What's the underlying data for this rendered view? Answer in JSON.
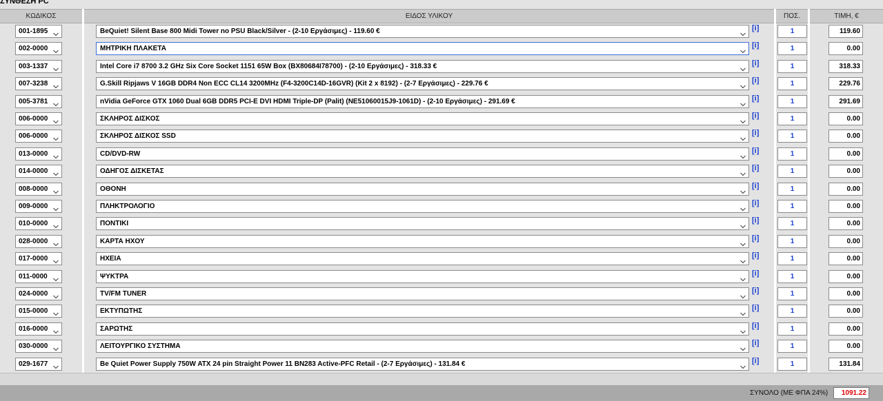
{
  "page_title": "ΣΥΝΘΕΣΗ PC",
  "headers": {
    "code": "ΚΩΔΙΚΟΣ",
    "item": "ΕΙΔΟΣ ΥΛΙΚΟΥ",
    "qty": "ΠΟΣ.",
    "price": "ΤΙΜΗ, €"
  },
  "info_label": "[i]",
  "rows": [
    {
      "code": "001-1895",
      "item": "BeQuiet! Silent Base 800 Midi Tower no PSU Black/Silver - (2-10 Εργάσιμες) - 119.60 €",
      "qty": "1",
      "price": "119.60"
    },
    {
      "code": "002-0000",
      "item": "ΜΗΤΡΙΚΗ ΠΛΑΚΕΤΑ",
      "qty": "1",
      "price": "0.00"
    },
    {
      "code": "003-1337",
      "item": "Intel Core i7 8700 3.2 GHz Six Core Socket 1151 65W Box (BX80684I78700) - (2-10 Εργάσιμες) - 318.33 €",
      "qty": "1",
      "price": "318.33"
    },
    {
      "code": "007-3238",
      "item": "G.Skill Ripjaws V 16GB DDR4 Non ECC CL14 3200MHz (F4-3200C14D-16GVR) (Kit 2 x 8192) - (2-7 Εργάσιμες) - 229.76 €",
      "qty": "1",
      "price": "229.76"
    },
    {
      "code": "005-3781",
      "item": "nVidia GeForce GTX 1060 Dual 6GB DDR5 PCI-E DVI HDMI Triple-DP (Palit) (NE51060015J9-1061D) - (2-10 Εργάσιμες) - 291.69 €",
      "qty": "1",
      "price": "291.69"
    },
    {
      "code": "006-0000",
      "item": "ΣΚΛΗΡΟΣ ΔΙΣΚΟΣ",
      "qty": "1",
      "price": "0.00"
    },
    {
      "code": "006-0000",
      "item": "ΣΚΛΗΡΟΣ ΔΙΣΚΟΣ SSD",
      "qty": "1",
      "price": "0.00"
    },
    {
      "code": "013-0000",
      "item": "CD/DVD-RW",
      "qty": "1",
      "price": "0.00"
    },
    {
      "code": "014-0000",
      "item": "ΟΔΗΓΟΣ ΔΙΣΚΕΤΑΣ",
      "qty": "1",
      "price": "0.00"
    },
    {
      "code": "008-0000",
      "item": "ΟΘΟΝΗ",
      "qty": "1",
      "price": "0.00"
    },
    {
      "code": "009-0000",
      "item": "ΠΛΗΚΤΡΟΛΟΓΙΟ",
      "qty": "1",
      "price": "0.00"
    },
    {
      "code": "010-0000",
      "item": "ΠΟΝΤΙΚΙ",
      "qty": "1",
      "price": "0.00"
    },
    {
      "code": "028-0000",
      "item": "ΚΑΡΤΑ ΗΧΟΥ",
      "qty": "1",
      "price": "0.00"
    },
    {
      "code": "017-0000",
      "item": "ΗΧΕΙΑ",
      "qty": "1",
      "price": "0.00"
    },
    {
      "code": "011-0000",
      "item": "ΨΥΚΤΡΑ",
      "qty": "1",
      "price": "0.00"
    },
    {
      "code": "024-0000",
      "item": "TV/FM TUNER",
      "qty": "1",
      "price": "0.00"
    },
    {
      "code": "015-0000",
      "item": "ΕΚΤΥΠΩΤΗΣ",
      "qty": "1",
      "price": "0.00"
    },
    {
      "code": "016-0000",
      "item": "ΣΑΡΩΤΗΣ",
      "qty": "1",
      "price": "0.00"
    },
    {
      "code": "030-0000",
      "item": "ΛΕΙΤΟΥΡΓΙΚΟ ΣΥΣΤΗΜΑ",
      "qty": "1",
      "price": "0.00"
    },
    {
      "code": "029-1677",
      "item": "Be Quiet Power Supply 750W ATX 24 pin Straight Power 11 BN283 Active-PFC Retail - (2-7 Εργάσιμες) - 131.84 €",
      "qty": "1",
      "price": "131.84"
    }
  ],
  "focused_row": 1,
  "total": {
    "label": "ΣΥΝΟΛΟ (ΜΕ ΦΠΑ 24%)",
    "value": "1091.22"
  },
  "colors": {
    "info_link": "#1a3fd0",
    "qty_text": "#1a3fd0",
    "total_value": "#e00000",
    "focus_border": "#3d6fd6"
  },
  "icons": {
    "dropdown": "chevron-down-icon"
  }
}
